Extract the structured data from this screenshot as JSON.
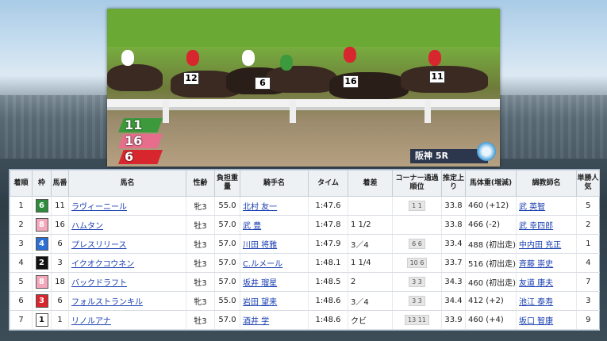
{
  "overlay": {
    "positions": [
      {
        "number": "11",
        "color": "#3c9a3c"
      },
      {
        "number": "16",
        "color": "#e66e8c"
      },
      {
        "number": "6",
        "color": "#d8262e"
      }
    ],
    "venue_label": "阪神 5R"
  },
  "video": {
    "cloths": [
      "12",
      "6",
      "16",
      "11"
    ]
  },
  "table": {
    "headers": [
      "着順",
      "枠",
      "馬番",
      "馬名",
      "性齢",
      "負担重量",
      "騎手名",
      "タイム",
      "着差",
      "コーナー通過順位",
      "推定上り",
      "馬体重(増減)",
      "調教師名",
      "単勝人気"
    ],
    "rows": [
      {
        "rank": "1",
        "waku": "6",
        "waku_bg": "#2e8b3e",
        "waku_fg": "#ffffff",
        "num": "11",
        "horse": "ラヴィーニール",
        "sex": "牝3",
        "weight": "55.0",
        "jockey": "北村 友一",
        "time": "1:47.6",
        "margin": "",
        "corner": "1 1",
        "last": "33.8",
        "body": "460 (+12)",
        "trainer": "武 英智",
        "pop": "5"
      },
      {
        "rank": "2",
        "waku": "8",
        "waku_bg": "#f3a7bb",
        "waku_fg": "#ffffff",
        "num": "16",
        "horse": "ハムタン",
        "sex": "牡3",
        "weight": "57.0",
        "jockey": "武 豊",
        "time": "1:47.8",
        "margin": "1 1/2",
        "corner": "",
        "last": "33.8",
        "body": "466 (-2)",
        "trainer": "武 幸四郎",
        "pop": "2"
      },
      {
        "rank": "3",
        "waku": "4",
        "waku_bg": "#2a6fd1",
        "waku_fg": "#ffffff",
        "num": "6",
        "horse": "プレスリリース",
        "sex": "牡3",
        "weight": "57.0",
        "jockey": "川田 将雅",
        "time": "1:47.9",
        "margin": "3／4",
        "corner": "6 6",
        "last": "33.4",
        "body": "488 (初出走)",
        "trainer": "中内田 充正",
        "pop": "1"
      },
      {
        "rank": "4",
        "waku": "2",
        "waku_bg": "#111111",
        "waku_fg": "#ffffff",
        "num": "3",
        "horse": "イクオクコウネン",
        "sex": "牡3",
        "weight": "57.0",
        "jockey": "C.ルメール",
        "time": "1:48.1",
        "margin": "1 1/4",
        "corner": "10 6",
        "last": "33.7",
        "body": "516 (初出走)",
        "trainer": "斉藤 崇史",
        "pop": "4"
      },
      {
        "rank": "5",
        "waku": "8",
        "waku_bg": "#f3a7bb",
        "waku_fg": "#ffffff",
        "num": "18",
        "horse": "バックドラフト",
        "sex": "牡3",
        "weight": "57.0",
        "jockey": "坂井 瑠星",
        "time": "1:48.5",
        "margin": "2",
        "corner": "3 3",
        "last": "34.3",
        "body": "460 (初出走)",
        "trainer": "友道 康夫",
        "pop": "7"
      },
      {
        "rank": "6",
        "waku": "3",
        "waku_bg": "#d8262e",
        "waku_fg": "#ffffff",
        "num": "6",
        "horse": "フォルストランキル",
        "sex": "牝3",
        "weight": "55.0",
        "jockey": "岩田 望来",
        "time": "1:48.6",
        "margin": "3／4",
        "corner": "3 3",
        "last": "34.4",
        "body": "412 (+2)",
        "trainer": "池江 泰寿",
        "pop": "3"
      },
      {
        "rank": "7",
        "waku": "1",
        "waku_bg": "#ffffff",
        "waku_fg": "#111111",
        "num": "1",
        "horse": "リノルアナ",
        "sex": "牡3",
        "weight": "57.0",
        "jockey": "酒井 学",
        "time": "1:48.6",
        "margin": "クビ",
        "corner": "13 11",
        "last": "33.9",
        "body": "460 (+4)",
        "trainer": "坂口 智康",
        "pop": "9"
      }
    ]
  }
}
